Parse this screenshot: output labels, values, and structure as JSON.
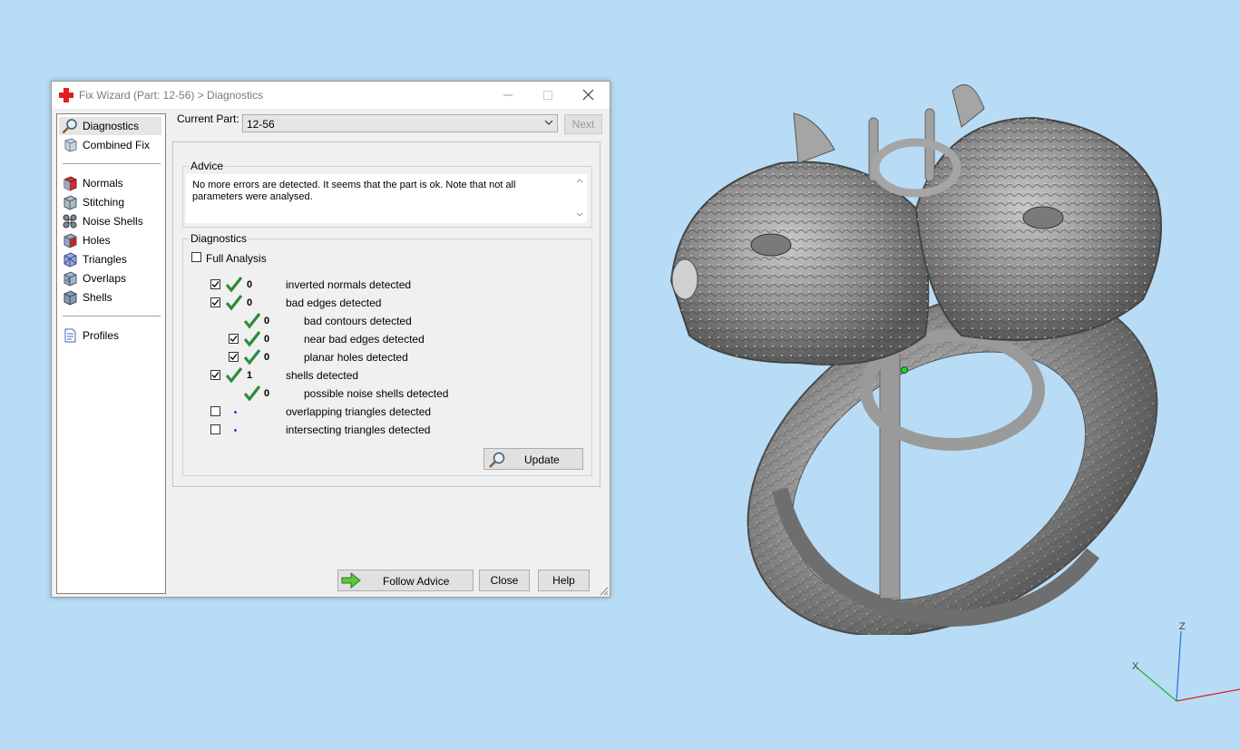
{
  "window": {
    "title": "Fix Wizard (Part: 12-56) > Diagnostics"
  },
  "nav": {
    "items": [
      {
        "label": "Diagnostics",
        "icon": "magnifier-icon",
        "selected": true
      },
      {
        "label": "Combined Fix",
        "icon": "part-icon"
      },
      {
        "label": "Normals",
        "icon": "normals-cube-icon"
      },
      {
        "label": "Stitching",
        "icon": "stitching-icon"
      },
      {
        "label": "Noise Shells",
        "icon": "noise-shells-icon"
      },
      {
        "label": "Holes",
        "icon": "holes-icon"
      },
      {
        "label": "Triangles",
        "icon": "triangles-icon"
      },
      {
        "label": "Overlaps",
        "icon": "overlaps-icon"
      },
      {
        "label": "Shells",
        "icon": "shells-icon"
      },
      {
        "label": "Profiles",
        "icon": "profiles-icon"
      }
    ]
  },
  "part": {
    "label": "Current Part:",
    "value": "12-56",
    "next_label": "Next"
  },
  "advice": {
    "title": "Advice",
    "text": "No more errors are detected. It seems that the part is ok. Note that not all parameters were analysed."
  },
  "diagnostics": {
    "title": "Diagnostics",
    "full_analysis_label": "Full Analysis",
    "full_analysis_checked": false,
    "rows": [
      {
        "checked": true,
        "status": "ok",
        "count": "0",
        "label": "inverted normals detected"
      },
      {
        "checked": true,
        "status": "ok",
        "count": "0",
        "label": "bad edges detected"
      },
      {
        "checked": null,
        "status": "ok",
        "count": "0",
        "label": "bad contours detected"
      },
      {
        "checked": true,
        "status": "ok",
        "count": "0",
        "label": "near bad edges detected"
      },
      {
        "checked": true,
        "status": "ok",
        "count": "0",
        "label": "planar holes detected"
      },
      {
        "checked": true,
        "status": "ok",
        "count": "1",
        "label": "shells detected"
      },
      {
        "checked": null,
        "status": "ok",
        "count": "0",
        "label": "possible noise shells detected"
      },
      {
        "checked": false,
        "status": "pending",
        "count": "",
        "label": "overlapping triangles detected"
      },
      {
        "checked": false,
        "status": "pending",
        "count": "",
        "label": "intersecting triangles detected"
      }
    ],
    "update_label": "Update"
  },
  "buttons": {
    "follow_advice": "Follow Advice",
    "close": "Close",
    "help": "Help"
  },
  "viewport": {
    "axes": {
      "z": "Z",
      "x": "X"
    },
    "colors": {
      "background": "#b8dcf6",
      "model": "#8a8a8a",
      "check": "#2e8b3a",
      "accent_red": "#e02020"
    }
  }
}
